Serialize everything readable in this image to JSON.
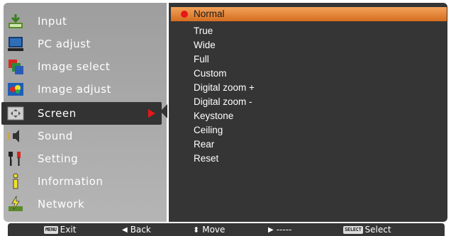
{
  "menu": {
    "items": [
      {
        "label": "Input",
        "icon": "input-icon"
      },
      {
        "label": "PC adjust",
        "icon": "pc-adjust-icon"
      },
      {
        "label": "Image select",
        "icon": "image-select-icon"
      },
      {
        "label": "Image adjust",
        "icon": "image-adjust-icon"
      },
      {
        "label": "Screen",
        "icon": "screen-icon",
        "selected": true
      },
      {
        "label": "Sound",
        "icon": "sound-icon"
      },
      {
        "label": "Setting",
        "icon": "setting-icon"
      },
      {
        "label": "Information",
        "icon": "information-icon"
      },
      {
        "label": "Network",
        "icon": "network-icon"
      }
    ]
  },
  "submenu": {
    "items": [
      {
        "label": "Normal",
        "active": true
      },
      {
        "label": "True"
      },
      {
        "label": "Wide"
      },
      {
        "label": "Full"
      },
      {
        "label": "Custom"
      },
      {
        "label": "Digital zoom +"
      },
      {
        "label": "Digital zoom -"
      },
      {
        "label": "Keystone"
      },
      {
        "label": "Ceiling"
      },
      {
        "label": "Rear"
      },
      {
        "label": "Reset"
      }
    ]
  },
  "footer": {
    "exit": {
      "key": "MENU",
      "label": "Exit"
    },
    "back": {
      "icon": "left-triangle-icon",
      "label": "Back"
    },
    "move": {
      "icon": "up-down-icon",
      "label": "Move"
    },
    "next": {
      "icon": "right-triangle-icon",
      "label": "-----"
    },
    "select": {
      "key": "SELECT",
      "label": "Select"
    }
  },
  "colors": {
    "highlight": "#e0822f",
    "selection_marker": "#e8171a",
    "panel_dark": "#353535",
    "panel_light": "#a8a8a8"
  }
}
